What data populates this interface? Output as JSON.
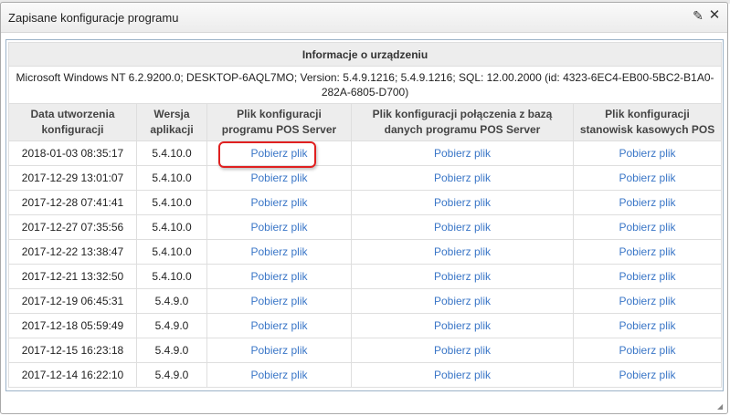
{
  "window": {
    "title": "Zapisane konfiguracje programu",
    "pin_icon": "pin-icon",
    "close_icon": "close-icon"
  },
  "device": {
    "heading": "Informacje o urządzeniu",
    "details": "Microsoft Windows NT 6.2.9200.0; DESKTOP-6AQL7MO; Version: 5.4.9.1216; 5.4.9.1216; SQL: 12.00.2000 (id: 4323-6EC4-EB00-5BC2-B1A0-282A-6805-D700)"
  },
  "columns": [
    "Data utworzenia konfiguracji",
    "Wersja aplikacji",
    "Plik konfiguracji programu POS Server",
    "Plik konfiguracji połączenia z bazą danych programu POS Server",
    "Plik konfiguracji stanowisk kasowych POS"
  ],
  "rows": [
    {
      "date": "2018-01-03 08:35:17",
      "version": "5.4.10.0",
      "pos_server": "Pobierz plik",
      "db": "Pobierz plik",
      "stations": "Pobierz plik"
    },
    {
      "date": "2017-12-29 13:01:07",
      "version": "5.4.10.0",
      "pos_server": "Pobierz plik",
      "db": "Pobierz plik",
      "stations": "Pobierz plik"
    },
    {
      "date": "2017-12-28 07:41:41",
      "version": "5.4.10.0",
      "pos_server": "Pobierz plik",
      "db": "Pobierz plik",
      "stations": "Pobierz plik"
    },
    {
      "date": "2017-12-27 07:35:56",
      "version": "5.4.10.0",
      "pos_server": "Pobierz plik",
      "db": "Pobierz plik",
      "stations": "Pobierz plik"
    },
    {
      "date": "2017-12-22 13:38:47",
      "version": "5.4.10.0",
      "pos_server": "Pobierz plik",
      "db": "Pobierz plik",
      "stations": "Pobierz plik"
    },
    {
      "date": "2017-12-21 13:32:50",
      "version": "5.4.10.0",
      "pos_server": "Pobierz plik",
      "db": "Pobierz plik",
      "stations": "Pobierz plik"
    },
    {
      "date": "2017-12-19 06:45:31",
      "version": "5.4.9.0",
      "pos_server": "Pobierz plik",
      "db": "Pobierz plik",
      "stations": "Pobierz plik"
    },
    {
      "date": "2017-12-18 05:59:49",
      "version": "5.4.9.0",
      "pos_server": "Pobierz plik",
      "db": "Pobierz plik",
      "stations": "Pobierz plik"
    },
    {
      "date": "2017-12-15 16:23:18",
      "version": "5.4.9.0",
      "pos_server": "Pobierz plik",
      "db": "Pobierz plik",
      "stations": "Pobierz plik"
    },
    {
      "date": "2017-12-14 16:22:10",
      "version": "5.4.9.0",
      "pos_server": "Pobierz plik",
      "db": "Pobierz plik",
      "stations": "Pobierz plik"
    }
  ],
  "colors": {
    "link": "#3a76c7",
    "highlight_border": "#e02020",
    "header_bg": "#ededed"
  }
}
